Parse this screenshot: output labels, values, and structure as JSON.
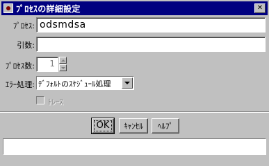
{
  "window": {
    "title": "ﾌﾟﾛｾｽの詳細設定",
    "close_label": "✕"
  },
  "form": {
    "process_label": "ﾌﾟﾛｾｽ:",
    "process_value": "odsmdsa",
    "args_label": "引数:",
    "args_value": "",
    "process_count_label": "ﾌﾟﾛｾｽ数:",
    "process_count_value": "1",
    "error_label": "ｴﾗｰ処理:",
    "error_value": "ﾃﾞﾌｫﾙﾄのｽｹｼﾞｭｰﾙ処理",
    "trace_label": "ﾄﾚｰｽ",
    "trace_checked": false
  },
  "buttons": {
    "ok": "OK",
    "cancel": "ｷｬﾝｾﾙ",
    "help": "ﾍﾙﾌﾟ"
  },
  "status": {
    "text": ""
  }
}
